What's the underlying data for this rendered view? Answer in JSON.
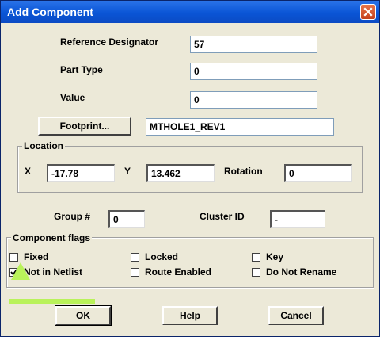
{
  "window": {
    "title": "Add Component"
  },
  "fields": {
    "reference_designator": {
      "label": "Reference Designator",
      "value": "57"
    },
    "part_type": {
      "label": "Part Type",
      "value": "0"
    },
    "value": {
      "label": "Value",
      "value": "0"
    },
    "footprint": {
      "button_label": "Footprint...",
      "value": "MTHOLE1_REV1"
    }
  },
  "location": {
    "legend": "Location",
    "x_label": "X",
    "x_value": "-17.78",
    "y_label": "Y",
    "y_value": "13.462",
    "rotation_label": "Rotation",
    "rotation_value": "0"
  },
  "group": {
    "label": "Group #",
    "value": "0"
  },
  "cluster": {
    "label": "Cluster ID",
    "value": "-"
  },
  "flags": {
    "legend": "Component flags",
    "items": [
      {
        "label": "Fixed",
        "checked": false
      },
      {
        "label": "Locked",
        "checked": false
      },
      {
        "label": "Key",
        "checked": false
      },
      {
        "label": "Not in Netlist",
        "checked": true
      },
      {
        "label": "Route Enabled",
        "checked": false
      },
      {
        "label": "Do Not Rename",
        "checked": false
      }
    ]
  },
  "buttons": {
    "ok": "OK",
    "help": "Help",
    "cancel": "Cancel"
  },
  "annotation": {
    "color": "#b9f25a"
  }
}
